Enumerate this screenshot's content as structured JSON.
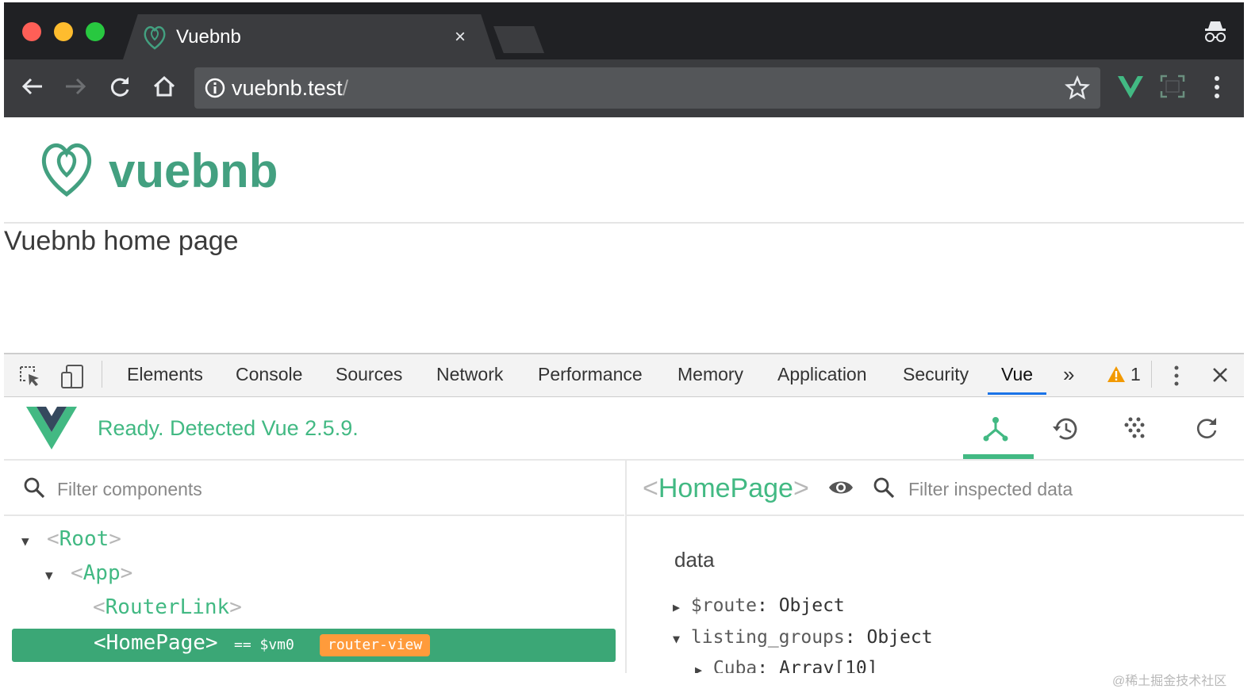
{
  "browser": {
    "tab_title": "Vuebnb",
    "tab_close": "×",
    "url_main": "vuebnb.test",
    "url_rest": "/"
  },
  "page": {
    "logo_text": "vuebnb",
    "heading": "Vuebnb home page"
  },
  "devtools": {
    "tabs": [
      {
        "label": "Elements"
      },
      {
        "label": "Console"
      },
      {
        "label": "Sources"
      },
      {
        "label": "Network"
      },
      {
        "label": "Performance"
      },
      {
        "label": "Memory"
      },
      {
        "label": "Application"
      },
      {
        "label": "Security"
      },
      {
        "label": "Vue"
      }
    ],
    "more_tabs": "»",
    "warning_count": "1",
    "active_tab": "Vue"
  },
  "vue_panel": {
    "status": "Ready. Detected Vue 2.5.9.",
    "filter_components_placeholder": "Filter components",
    "filter_data_placeholder": "Filter inspected data",
    "tree": {
      "root": "Root",
      "app": "App",
      "router_link": "RouterLink",
      "selected": "<HomePage>",
      "selected_vm": "== $vm0",
      "selected_badge": "router-view"
    },
    "inspector": {
      "component": "HomePage",
      "section": "data",
      "props": [
        {
          "key": "$route",
          "value": "Object"
        },
        {
          "key": "listing_groups",
          "value": "Object"
        },
        {
          "key": "Cuba",
          "value": "Array[10]"
        }
      ]
    }
  },
  "watermark": "@稀土掘金技术社区",
  "colors": {
    "vue_green": "#42b983",
    "logo_green": "#43a080",
    "badge_orange": "#ff9b3b"
  }
}
